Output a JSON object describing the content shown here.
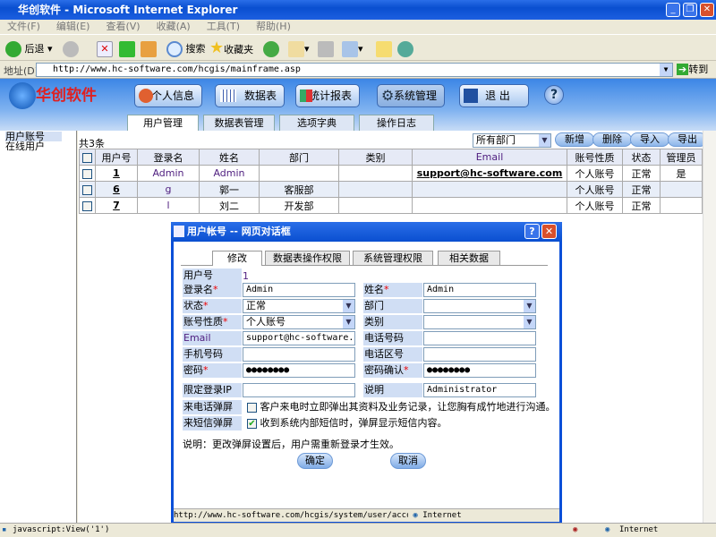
{
  "window": {
    "title": "华创软件 - Microsoft Internet Explorer"
  },
  "menu": [
    "文件(F)",
    "编辑(E)",
    "查看(V)",
    "收藏(A)",
    "工具(T)",
    "帮助(H)"
  ],
  "toolbar": {
    "back": "后退",
    "search": "搜索",
    "favorites": "收藏夹"
  },
  "address": {
    "label": "地址(D)",
    "url": "http://www.hc-software.com/hcgis/mainframe.asp",
    "go": "转到"
  },
  "app": {
    "logo": "华创软件",
    "nav": [
      "个人信息",
      "数据表",
      "统计报表",
      "系统管理",
      "退 出"
    ],
    "help": "?",
    "tabs": [
      "用户管理",
      "数据表管理",
      "选项字典",
      "操作日志"
    ],
    "active_tab": 0
  },
  "sidebar": [
    "用户账号",
    "在线用户"
  ],
  "list": {
    "count": "共3条",
    "dept_filter": "所有部门",
    "buttons": [
      "新增",
      "删除",
      "导入",
      "导出"
    ],
    "columns": [
      "用户号",
      "登录名",
      "姓名",
      "部门",
      "类别",
      "Email",
      "账号性质",
      "状态",
      "管理员"
    ],
    "rows": [
      [
        "1",
        "Admin",
        "Admin",
        "",
        "",
        "support@hc-software.com",
        "个人账号",
        "正常",
        "是"
      ],
      [
        "6",
        "g",
        "郭一",
        "客服部",
        "",
        "",
        "个人账号",
        "正常",
        ""
      ],
      [
        "7",
        "l",
        "刘二",
        "开发部",
        "",
        "",
        "个人账号",
        "正常",
        ""
      ]
    ]
  },
  "dialog": {
    "title": "用户帐号 -- 网页对话框",
    "tabs": [
      "修改",
      "数据表操作权限",
      "系统管理权限",
      "相关数据"
    ],
    "user_id_label": "用户号",
    "user_id": "1",
    "login_label": "登录名",
    "login": "Admin",
    "name_label": "姓名",
    "name": "Admin",
    "status_label": "状态",
    "status": "正常",
    "dept_label": "部门",
    "dept": "",
    "acct_type_label": "账号性质",
    "acct_type": "个人账号",
    "category_label": "类别",
    "category": "",
    "email_label": "Email",
    "email": "support@hc-software.com",
    "phone_label": "电话号码",
    "phone": "",
    "mobile_label": "手机号码",
    "mobile": "",
    "area_label": "电话区号",
    "area": "",
    "pwd_label": "密码",
    "pwd": "●●●●●●●●",
    "pwd2_label": "密码确认",
    "pwd2": "●●●●●●●●",
    "ip_label": "限定登录IP",
    "ip": "",
    "desc_label": "说明",
    "desc": "Administrator",
    "call_label": "来电话弹屏",
    "call_text": "客户来电时立即弹出其资料及业务记录，让您胸有成竹地进行沟通。",
    "call_checked": false,
    "sms_label": "来短信弹屏",
    "sms_text": "收到系统内部短信时，弹屏显示短信内容。",
    "sms_checked": true,
    "note": "说明：更改弹屏设置后，用户需重新登录才生效。",
    "ok": "确定",
    "cancel": "取消",
    "status_url": "http://www.hc-software.com/hcgis/system/user/account/fr",
    "zone": "Internet"
  },
  "status": {
    "text": "javascript:View('1')",
    "zone": "Internet"
  }
}
